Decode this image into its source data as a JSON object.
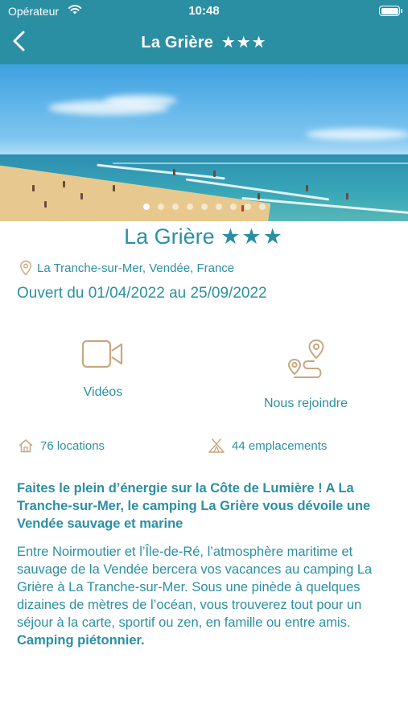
{
  "status_bar": {
    "carrier": "Opérateur",
    "time": "10:48"
  },
  "nav": {
    "title": "La Grière",
    "stars": "★★★"
  },
  "gallery": {
    "dot_count": 9,
    "active_index": 0
  },
  "camping": {
    "name": "La Grière",
    "stars": "★★★",
    "location": "La Tranche-sur-Mer, Vendée, France",
    "opening": "Ouvert du 01/04/2022 au 25/09/2022"
  },
  "actions": {
    "videos_label": "Vidéos",
    "directions_label": "Nous rejoindre"
  },
  "stats": {
    "rentals": "76 locations",
    "pitches": "44 emplacements"
  },
  "description": {
    "headline": "Faites le plein d’énergie sur la Côte de Lumière ! A La Tranche-sur-Mer, le camping La Grière vous dévoile une Vendée sauvage et marine",
    "body": "Entre Noirmoutier et l’Île-de-Ré, l’atmosphère maritime et sauvage de la Vendée bercera vos vacances au camping La Grière à La Tranche-sur-Mer. Sous une pinède à quelques dizaines de mètres de l’océan, vous trouverez tout pour un séjour à la carte, sportif ou zen, en famille ou entre amis.",
    "body_bold": "Camping piétonnier."
  },
  "colors": {
    "primary": "#2b8fa3",
    "icon_accent": "#c8a77f",
    "background": "#ffffff"
  },
  "icons": {
    "back": "chevron-left-icon",
    "location": "map-pin-icon",
    "videos": "video-camera-icon",
    "directions": "route-icon",
    "rentals": "house-icon",
    "pitches": "tent-icon"
  }
}
